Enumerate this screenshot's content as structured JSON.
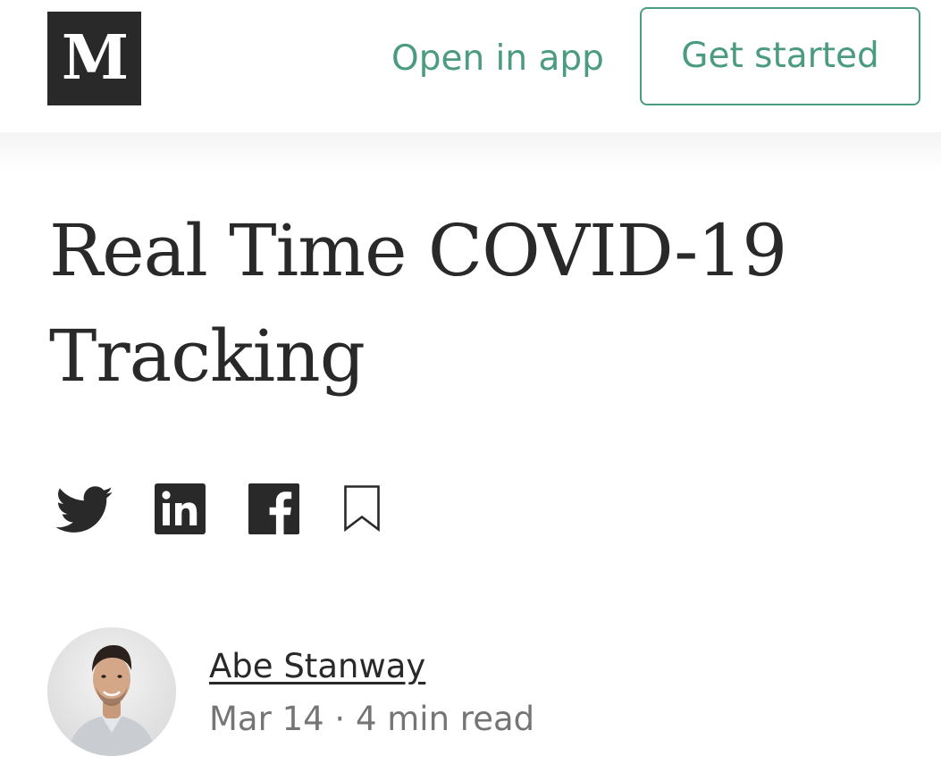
{
  "header": {
    "logo_text": "M",
    "logo_name": "medium-logo",
    "open_in_app_label": "Open in app",
    "get_started_label": "Get started"
  },
  "article": {
    "title": "Real Time COVID-19 Tracking"
  },
  "share": {
    "icons": [
      "twitter-icon",
      "linkedin-icon",
      "facebook-icon",
      "bookmark-icon"
    ]
  },
  "author": {
    "name": "Abe Stanway",
    "date": "Mar 14",
    "separator": "·",
    "read_time": "4 min read"
  },
  "colors": {
    "accent": "#4a9b7f",
    "text": "#292929",
    "muted": "#757575",
    "logo_bg": "#292929"
  }
}
